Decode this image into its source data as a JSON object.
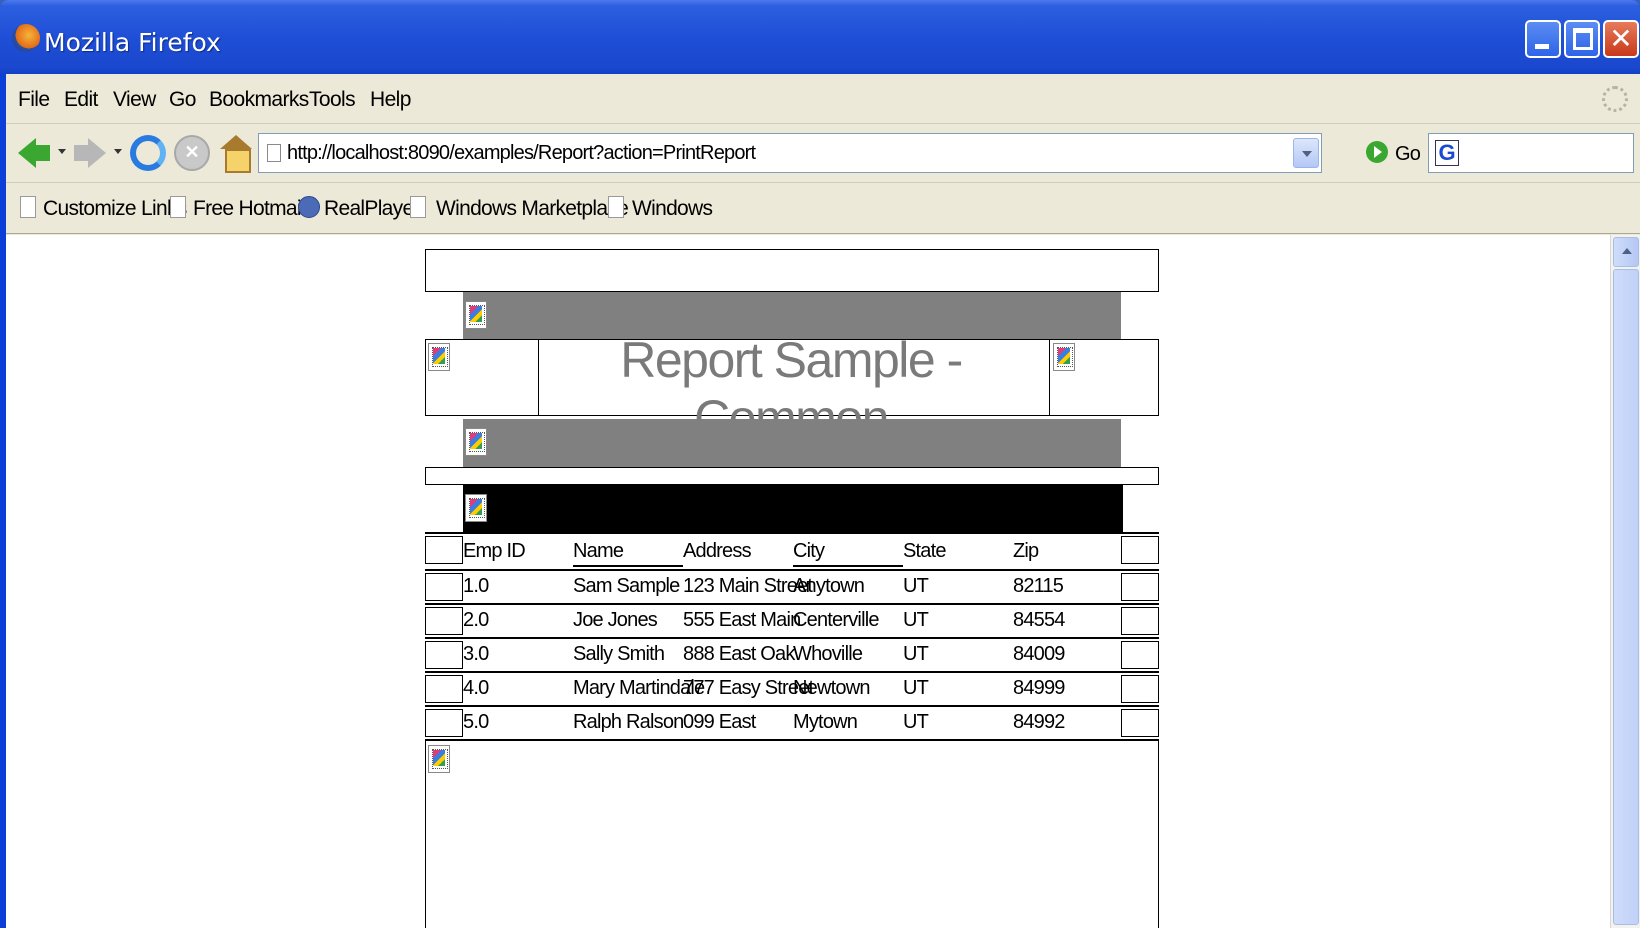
{
  "window": {
    "title": "Mozilla Firefox"
  },
  "menu": [
    "File",
    "Edit",
    "View",
    "Go",
    "Bookmarks",
    "Tools",
    "Help"
  ],
  "nav": {
    "url": "http://localhost:8090/examples/Report?action=PrintReport",
    "go_label": "Go"
  },
  "bookmarks": [
    "Customize Links",
    "Free Hotmail",
    "RealPlayer",
    "Windows Marketplace",
    "Windows"
  ],
  "report": {
    "title": "Report Sample - Common",
    "columns": [
      "Emp ID",
      "Name",
      "Address",
      "City",
      "State",
      "Zip"
    ],
    "rows": [
      [
        "1.0",
        "Sam Sample",
        "123 Main Street",
        "Anytown",
        "UT",
        "82115"
      ],
      [
        "2.0",
        "Joe Jones",
        "555 East Main",
        "Centerville",
        "UT",
        "84554"
      ],
      [
        "3.0",
        "Sally Smith",
        "888 East Oak",
        "Whoville",
        "UT",
        "84009"
      ],
      [
        "4.0",
        "Mary Martindale",
        "777 Easy Street",
        "Newtown",
        "UT",
        "84999"
      ],
      [
        "5.0",
        "Ralph Ralson",
        "099 East",
        "Mytown",
        "UT",
        "84992"
      ]
    ],
    "colors": {
      "band_gray": "#808080",
      "band_black": "#000000",
      "title_text": "#7a7a7a"
    }
  }
}
